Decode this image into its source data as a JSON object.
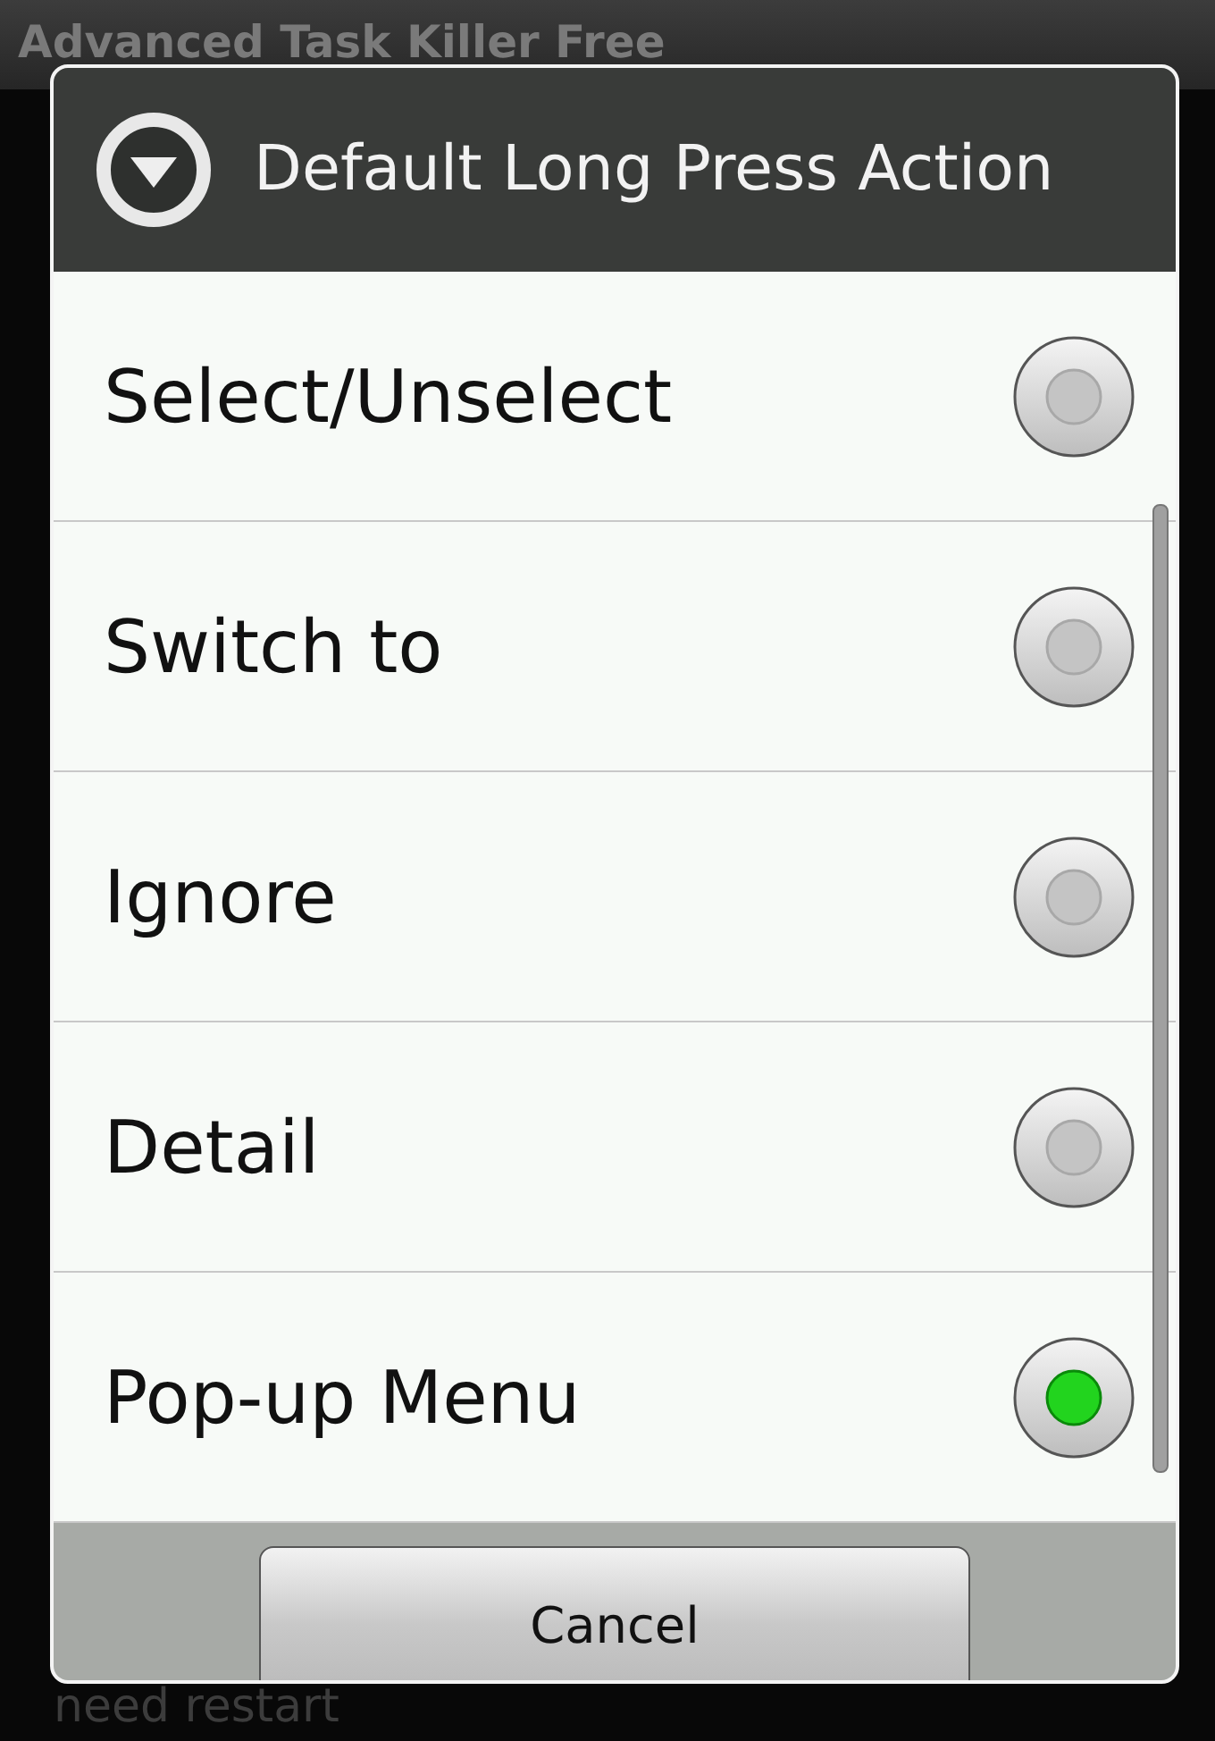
{
  "app_bar": {
    "title": "Advanced Task Killer Free"
  },
  "background": {
    "note": "need restart"
  },
  "dialog": {
    "title": "Default Long Press Action",
    "options": [
      {
        "label": "Select/Unselect",
        "selected": false
      },
      {
        "label": "Switch to",
        "selected": false
      },
      {
        "label": "Ignore",
        "selected": false
      },
      {
        "label": "Detail",
        "selected": false
      },
      {
        "label": "Pop-up Menu",
        "selected": true
      }
    ],
    "buttons": [
      "Cancel"
    ]
  }
}
